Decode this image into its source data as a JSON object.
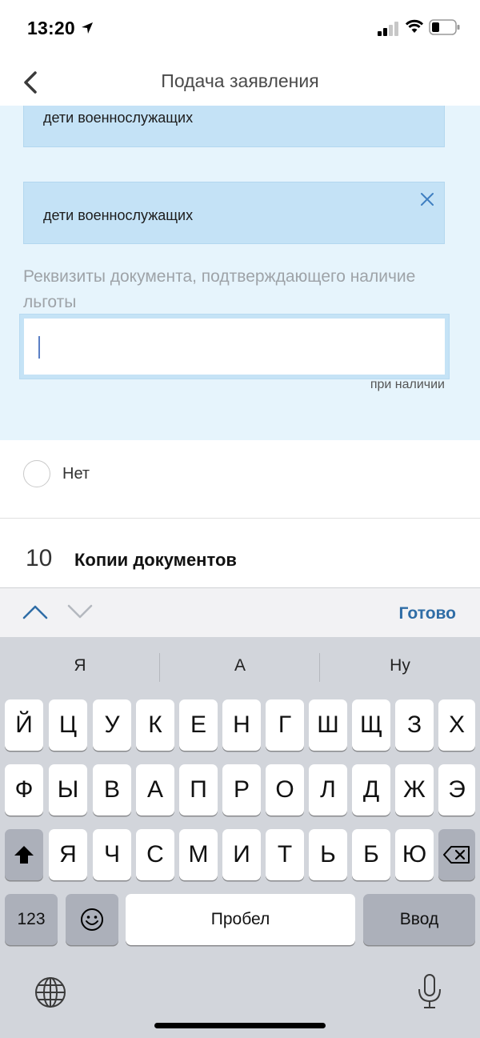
{
  "status": {
    "time": "13:20"
  },
  "nav": {
    "title": "Подача заявления"
  },
  "form": {
    "chip_top": "дети военнослужащих",
    "chip_main": "дети военнослужащих",
    "field_label": "Реквизиты документа, подтверждающего наличие льготы",
    "field_value": "",
    "hint": "при наличии"
  },
  "radio": {
    "label": "Нет"
  },
  "section": {
    "number": "10",
    "title": "Копии документов"
  },
  "accessory": {
    "done_label": "Готово"
  },
  "keyboard": {
    "suggestions": [
      "Я",
      "А",
      "Ну"
    ],
    "row1": [
      "Й",
      "Ц",
      "У",
      "К",
      "Е",
      "Н",
      "Г",
      "Ш",
      "Щ",
      "З",
      "Х"
    ],
    "row2": [
      "Ф",
      "Ы",
      "В",
      "А",
      "П",
      "Р",
      "О",
      "Л",
      "Д",
      "Ж",
      "Э"
    ],
    "row3": [
      "Я",
      "Ч",
      "С",
      "М",
      "И",
      "Т",
      "Ь",
      "Б",
      "Ю"
    ],
    "numbers_label": "123",
    "space_label": "Пробел",
    "return_label": "Ввод"
  },
  "colors": {
    "accent": "#2f6da6",
    "form_bg": "#e6f4fc",
    "chip_bg": "#c4e2f6"
  }
}
